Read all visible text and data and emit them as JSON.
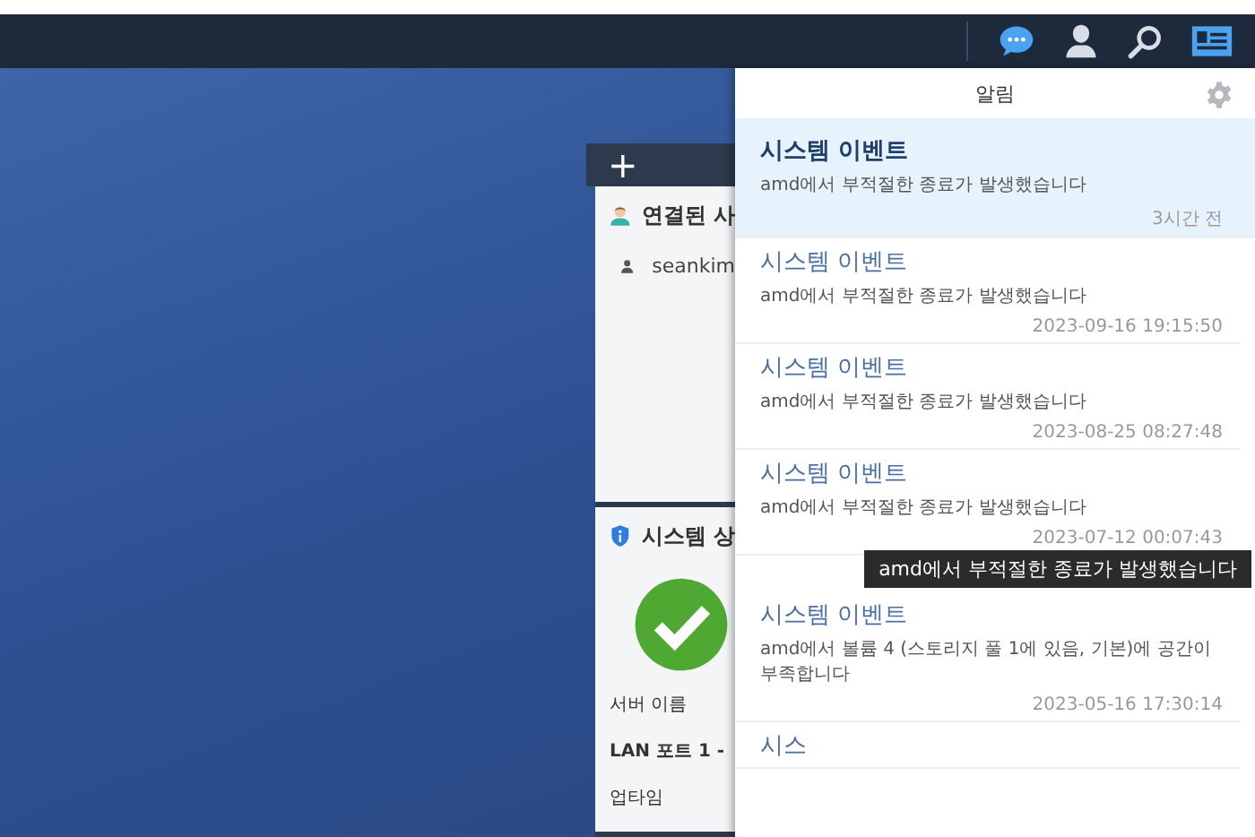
{
  "widgets": {
    "add_label": "+",
    "connected_users": {
      "title": "연결된 사",
      "users": [
        "seankim"
      ]
    },
    "system_status": {
      "title": "시스템 상",
      "fields": [
        {
          "label": "서버 이름",
          "bold": false
        },
        {
          "label": "LAN 포트 1 -",
          "bold": true
        },
        {
          "label": "업타임",
          "bold": false
        }
      ]
    }
  },
  "notifications": {
    "title": "알림",
    "items": [
      {
        "title": "시스템 이벤트",
        "message": "amd에서 부적절한 종료가 발생했습니다",
        "time": "3시간 전",
        "selected": true
      },
      {
        "title": "시스템 이벤트",
        "message": "amd에서 부적절한 종료가 발생했습니다",
        "time": "2023-09-16 19:15:50",
        "selected": false
      },
      {
        "title": "시스템 이벤트",
        "message": "amd에서 부적절한 종료가 발생했습니다",
        "time": "2023-08-25 08:27:48",
        "selected": false
      },
      {
        "title": "시스템 이벤트",
        "message": "amd에서 부적절한 종료가 발생했습니다",
        "time": "2023-07-12 00:07:43",
        "selected": false,
        "tooltip": "amd에서 부적절한 종료가 발생했습니다"
      },
      {
        "title": "시스템 이벤트",
        "message": "amd에서 볼륨 4 (스토리지 풀 1에 있음, 기본)에 공간이 부족합니다",
        "time": "2023-05-16 17:30:14",
        "selected": false
      },
      {
        "title": "시스",
        "selected": false
      }
    ]
  }
}
